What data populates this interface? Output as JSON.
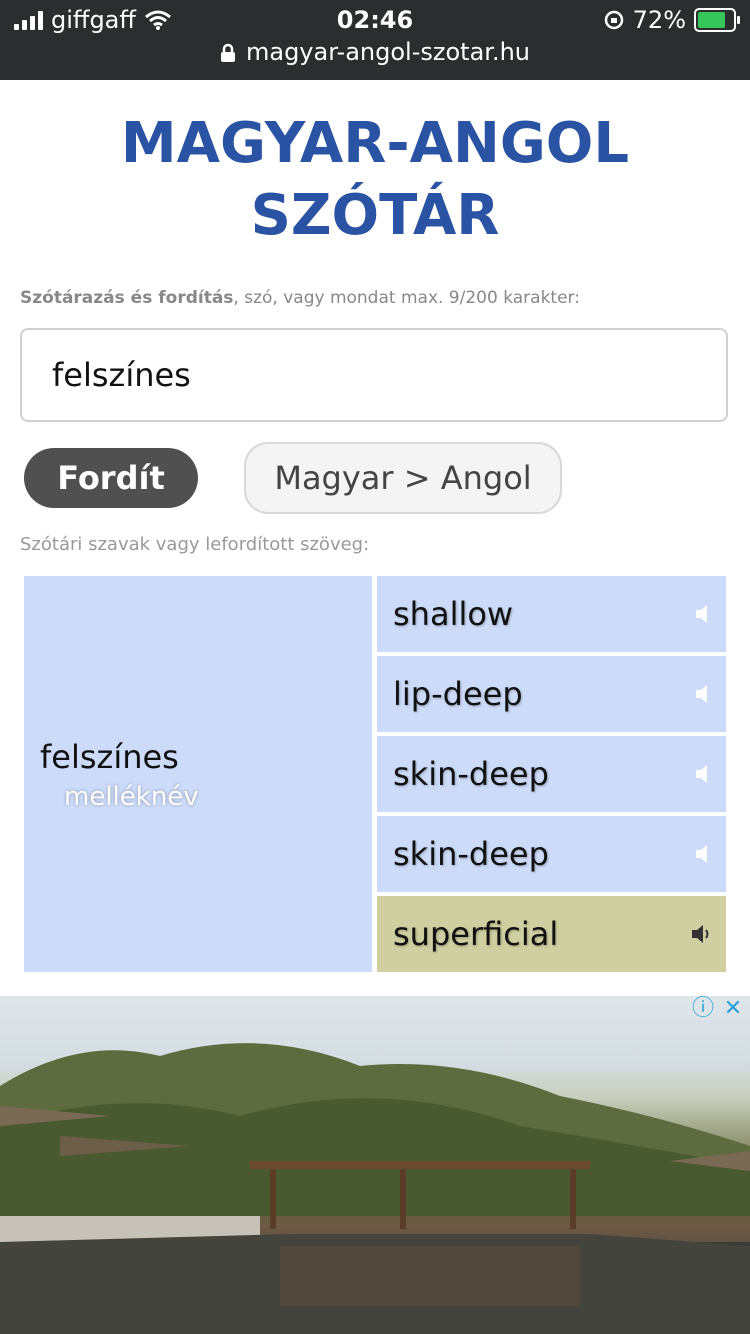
{
  "status": {
    "carrier": "giffgaff",
    "time": "02:46",
    "battery": "72%",
    "url": "magyar-angol-szotar.hu"
  },
  "page": {
    "title_line1": "MAGYAR-ANGOL",
    "title_line2": "SZÓTÁR",
    "hint_bold": "Szótárazás és fordítás",
    "hint_rest": ", szó, vagy mondat max. 9/200 karakter:",
    "search_value": "felszínes",
    "translate_button": "Fordít",
    "lang_button": "Magyar > Angol",
    "results_hint": "Szótári szavak vagy lefordított szöveg:"
  },
  "result": {
    "word": "felszínes",
    "pos": "melléknév",
    "translations": [
      {
        "text": "shallow"
      },
      {
        "text": "lip-deep"
      },
      {
        "text": "skin-deep"
      },
      {
        "text": "skin-deep"
      },
      {
        "text": "superficial"
      }
    ]
  },
  "colors": {
    "title": "#2a53a3",
    "result_bg": "#ccdbf9",
    "highlight_bg": "#cfcfa2"
  }
}
